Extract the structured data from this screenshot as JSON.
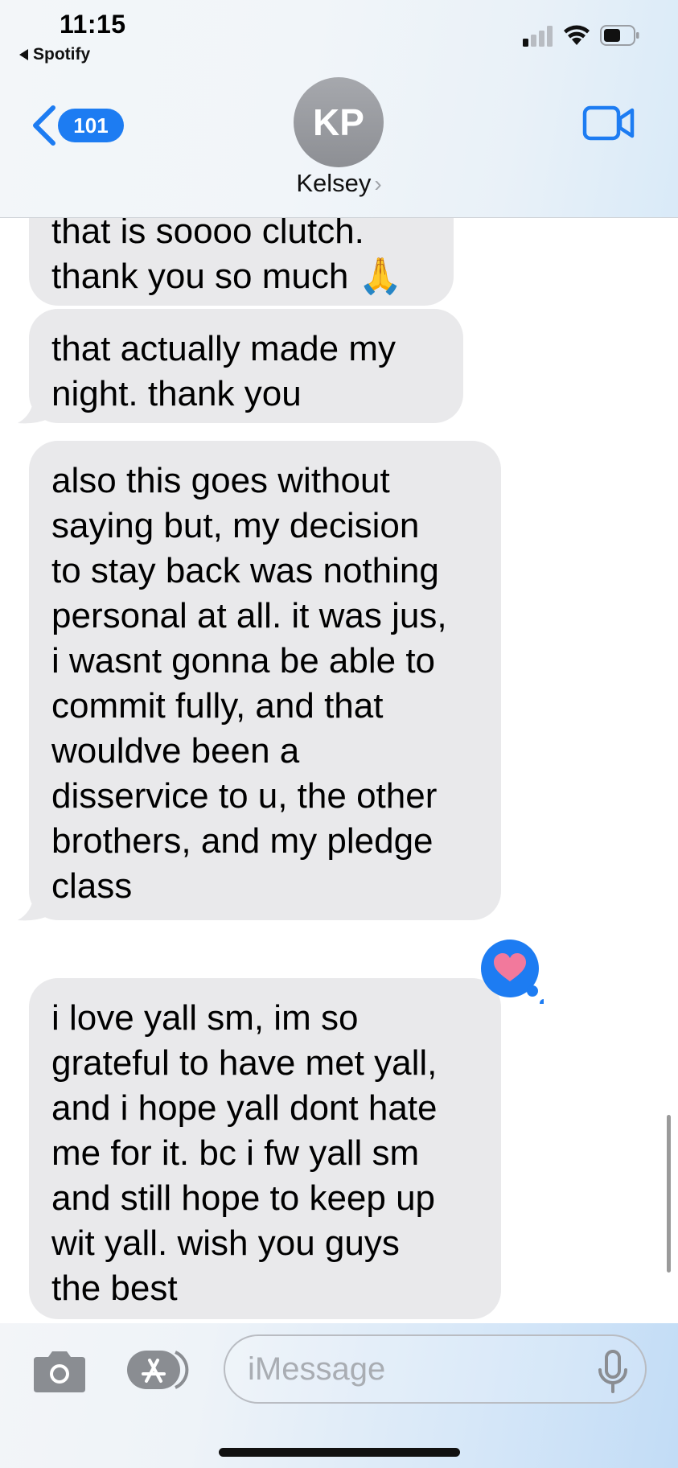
{
  "status": {
    "time": "11:15",
    "back_app": "Spotify"
  },
  "nav": {
    "unread_count": "101",
    "avatar_initials": "KP",
    "contact_name": "Kelsey",
    "contact_chevron": "›"
  },
  "messages": [
    {
      "text": "that is soooo clutch.\nthank you so much 🙏",
      "sender": "Kelsey"
    },
    {
      "text": "that actually made my\nnight. thank you",
      "sender": "Kelsey"
    },
    {
      "text": "also this goes without\nsaying but, my decision\nto stay back was nothing\npersonal at all. it was jus,\ni wasnt gonna be able to\ncommit fully, and that\nwouldve been a\ndisservice to u, the other\nbrothers, and my pledge\nclass",
      "sender": "Kelsey"
    },
    {
      "text": "i love yall sm, im so\ngrateful to have met yall,\nand i hope yall dont hate\nme for it. bc i fw yall sm\nand still hope to keep up\nwit yall. wish you guys\nthe best",
      "sender": "Kelsey",
      "reaction": "heart"
    }
  ],
  "input": {
    "placeholder": "iMessage"
  },
  "colors": {
    "accent": "#1d7cf2",
    "bubble_received": "#e9e9eb",
    "reaction_heart": "#f2799c"
  },
  "icons": [
    "signal-icon",
    "wifi-icon",
    "battery-icon",
    "back-chevron-icon",
    "video-call-icon",
    "camera-icon",
    "app-store-icon",
    "microphone-icon",
    "heart-reaction-icon"
  ]
}
